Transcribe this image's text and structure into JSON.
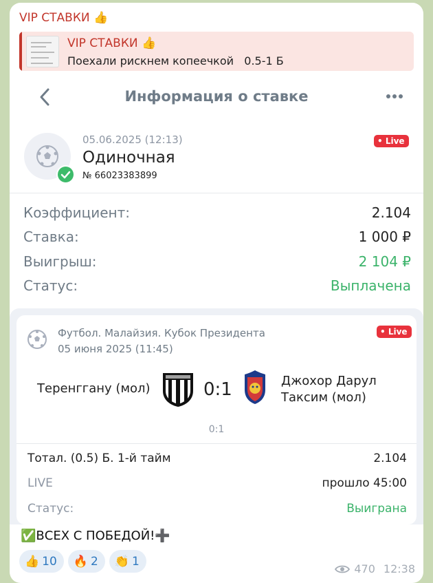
{
  "channel": {
    "name": "VIP СТАВКИ",
    "emoji": "👍"
  },
  "reply": {
    "title": "VIP СТАВКИ",
    "emoji": "👍",
    "text": "Поехали рискнем копеечкой   0.5-1 Б"
  },
  "nav": {
    "title": "Информация о ставке"
  },
  "bet": {
    "date": "05.06.2025 (12:13)",
    "type": "Одиночная",
    "number": "№ 66023383899",
    "live": "• Live"
  },
  "details": [
    {
      "label": "Коэффициент:",
      "value": "2.104"
    },
    {
      "label": "Ставка:",
      "value": "1 000 ₽"
    },
    {
      "label": "Выигрыш:",
      "value": "2 104 ₽"
    },
    {
      "label": "Статус:",
      "value": "Выплачена"
    }
  ],
  "match": {
    "league": "Футбол. Малайзия. Кубок Президента",
    "date": "05 июня 2025 (11:45)",
    "live": "• Live",
    "team1": "Теренггану (мол)",
    "team2_line1": "Джохор Дарул",
    "team2_line2": "Таксим (мол)",
    "score": "0:1",
    "half_score": "0:1",
    "market": "Тотал. (0.5) Б. 1-й тайм",
    "odds": "2.104",
    "state_label": "LIVE",
    "state_value": "прошло 45:00",
    "status_label": "Статус:",
    "status_value": "Выиграна"
  },
  "caption": {
    "check": "✅",
    "text": "ВСЕХ С ПОБЕДОЙ!",
    "plus": "➕"
  },
  "reactions": [
    {
      "icon": "👍",
      "count": "10"
    },
    {
      "icon": "🔥",
      "count": "2"
    },
    {
      "icon": "👏",
      "count": "1"
    }
  ],
  "meta": {
    "views": "470",
    "time": "12:38"
  },
  "colors": {
    "accent_red": "#c2362b",
    "live_red": "#e8323c",
    "win_green": "#3bb36a",
    "link_blue": "#2e78bf"
  }
}
